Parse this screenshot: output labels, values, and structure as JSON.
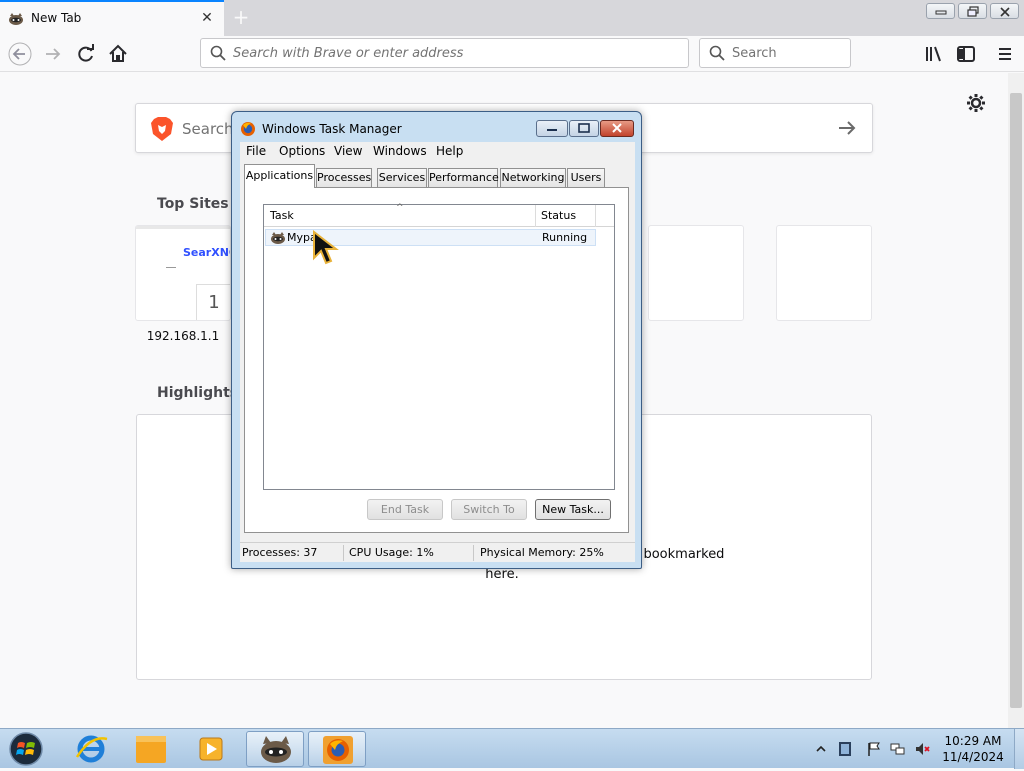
{
  "browser": {
    "tab_title": "New Tab",
    "url_placeholder": "Search with Brave or enter address",
    "search_placeholder": "Search"
  },
  "newtab": {
    "search_label": "Search",
    "top_sites_heading": "Top Sites",
    "top_site_1": {
      "brand": "SearXNG",
      "number": "1",
      "label": "192.168.1.1"
    },
    "highlights_heading": "Highlights",
    "highlights_message": "cles, videos, and other pages you've recently visited or bookmarked here."
  },
  "taskmgr": {
    "title": "Windows Task Manager",
    "menu": [
      "File",
      "Options",
      "View",
      "Windows",
      "Help"
    ],
    "tabs": [
      "Applications",
      "Processes",
      "Services",
      "Performance",
      "Networking",
      "Users"
    ],
    "columns": {
      "task": "Task",
      "status": "Status"
    },
    "rows": [
      {
        "task": "Mypa",
        "status": "Running"
      }
    ],
    "buttons": {
      "end_task": "End Task",
      "switch_to": "Switch To",
      "new_task": "New Task..."
    },
    "statusbar": {
      "processes": "Processes: 37",
      "cpu": "CPU Usage: 1%",
      "memory": "Physical Memory: 25%"
    }
  },
  "taskbar": {
    "clock_time": "10:29 AM",
    "clock_date": "11/4/2024"
  },
  "colors": {
    "accent": "#0a84ff",
    "taskbar": "#b8d1ea",
    "window_frame": "#c8dff2",
    "close_button": "#c2432c"
  },
  "icons": [
    "raccoon-icon",
    "close-icon",
    "plus-icon",
    "back-icon",
    "forward-icon",
    "reload-icon",
    "home-icon",
    "search-icon",
    "library-icon",
    "sidebar-icon",
    "menu-icon",
    "gear-icon",
    "brave-lion-icon",
    "arrow-right-icon",
    "firefox-icon",
    "windows-start-icon",
    "ie-icon",
    "folder-icon",
    "media-player-icon",
    "flag-icon",
    "network-icon",
    "volume-muted-icon"
  ]
}
